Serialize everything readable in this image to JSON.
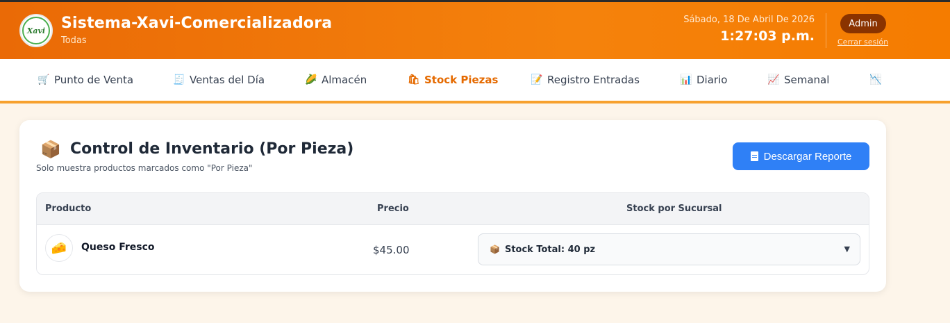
{
  "header": {
    "logo_text": "Xavi",
    "title": "Sistema-Xavi-Comercializadora",
    "subtitle": "Todas",
    "date": "Sábado, 18 De Abril De 2026",
    "time": "1:27:03 p.m.",
    "user_badge": "Admin",
    "logout": "Cerrar sesión"
  },
  "nav": {
    "items": [
      {
        "label": "Punto de Venta",
        "icon": "cart-icon",
        "glyph": "🛒"
      },
      {
        "label": "Ventas del Día",
        "icon": "receipt-icon",
        "glyph": "🧾"
      },
      {
        "label": "Almacén",
        "icon": "corn-icon",
        "glyph": "🌽"
      },
      {
        "label": "Stock Piezas",
        "icon": "bag-icon",
        "glyph": "🛍"
      },
      {
        "label": "Registro Entradas",
        "icon": "memo-icon",
        "glyph": "📝"
      },
      {
        "label": "Diario",
        "icon": "bar-chart-icon",
        "glyph": "📊"
      },
      {
        "label": "Semanal",
        "icon": "trend-up-icon",
        "glyph": "📈"
      },
      {
        "label": "",
        "icon": "trend-down-icon",
        "glyph": "📉"
      }
    ],
    "active_index": 3
  },
  "card": {
    "icon": "package-icon",
    "icon_glyph": "📦",
    "title": "Control de Inventario (Por Pieza)",
    "subtitle": "Solo muestra productos marcados como \"Por Pieza\"",
    "download_label": "Descargar Reporte"
  },
  "table": {
    "columns": [
      "Producto",
      "Precio",
      "Stock por Sucursal"
    ],
    "rows": [
      {
        "product": "Queso Fresco",
        "icon": "cheese-icon",
        "glyph": "🧀",
        "price": "$45.00",
        "stock": "Stock Total: 40 pz"
      }
    ]
  },
  "colors": {
    "header_orange": "#f57c00",
    "active_tab": "#e56a00",
    "button_blue": "#2f80f6",
    "admin_badge": "#8a3300"
  }
}
